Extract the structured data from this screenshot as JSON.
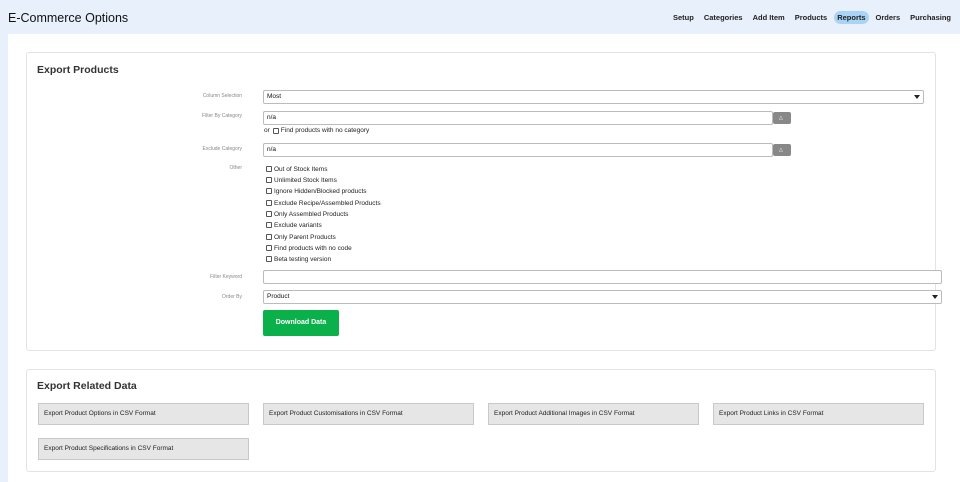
{
  "app": {
    "title": "E-Commerce Options"
  },
  "nav": [
    {
      "label": "Setup",
      "active": false
    },
    {
      "label": "Categories",
      "active": false
    },
    {
      "label": "Add Item",
      "active": false
    },
    {
      "label": "Products",
      "active": false
    },
    {
      "label": "Reports",
      "active": true
    },
    {
      "label": "Orders",
      "active": false
    },
    {
      "label": "Purchasing",
      "active": false
    }
  ],
  "export_products": {
    "title": "Export Products",
    "column_selection": {
      "label": "Column Selection",
      "value": "Most"
    },
    "filter_by_category": {
      "label": "Filter By Category",
      "value": "n/a"
    },
    "or_text": "or",
    "no_category_label": "Find products with no category",
    "exclude_category": {
      "label": "Exclude Category",
      "value": "n/a"
    },
    "other_label": "Other",
    "other_options": [
      "Out of Stock Items",
      "Unlimited Stock Items",
      "Ignore Hidden/Blocked products",
      "Exclude Recipe/Assembled Products",
      "Only Assembled Products",
      "Exclude variants",
      "Only Parent Products",
      "Find products with no code",
      "Beta testing version"
    ],
    "filter_keyword": {
      "label": "Filter Keyword",
      "value": ""
    },
    "order_by": {
      "label": "Order By",
      "value": "Product"
    },
    "download_label": "Download Data"
  },
  "export_related": {
    "title": "Export Related Data",
    "buttons": [
      "Export Product Options in CSV Format",
      "Export Product Customisations in CSV Format",
      "Export Product Additional Images in CSV Format",
      "Export Product Links in CSV Format",
      "Export Product Specifications in CSV Format"
    ]
  },
  "colors": {
    "background": "#e8f0fb",
    "active_tab": "#a9d4f5",
    "download_button": "#0ab14a"
  }
}
